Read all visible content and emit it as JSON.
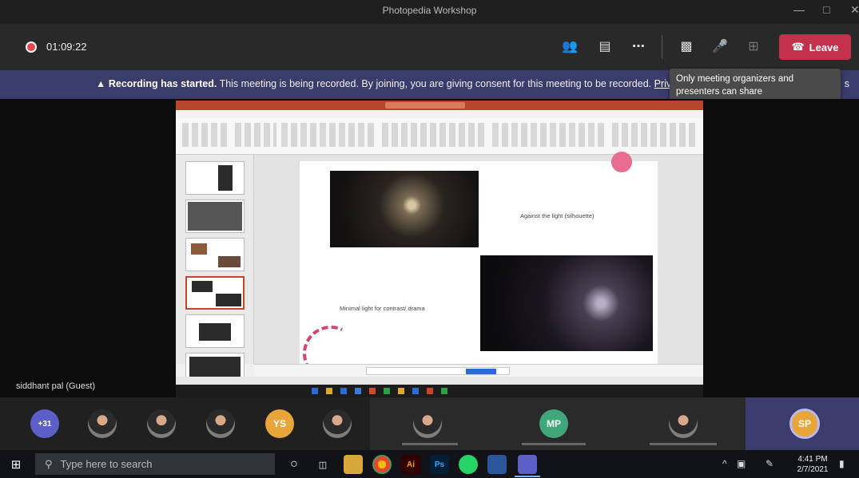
{
  "window": {
    "title": "Photopedia Workshop"
  },
  "toolbar": {
    "timer": "01:09:22",
    "leave_label": "Leave"
  },
  "banner": {
    "bold": "Recording has started.",
    "text": "This meeting is being recorded. By joining, you are giving consent for this meeting to be recorded.",
    "privacy": "Privac",
    "tail": "s"
  },
  "tooltip": {
    "text": "Only meeting organizers and presenters can share"
  },
  "stage": {
    "guest_label": "siddhant pal (Guest)"
  },
  "slide": {
    "caption1": "Against the light (silhouette)",
    "caption2": "Minimal light for contrast/ drama"
  },
  "participants": {
    "overflow_count": "+31",
    "initials": [
      "YS",
      "MP",
      "SP"
    ]
  },
  "taskbar": {
    "search_placeholder": "Type here to search",
    "time": "4:41 PM",
    "date": "2/7/2021"
  },
  "colors": {
    "leave": "#c4314b",
    "banner": "#3a3c6b",
    "recording": "#e5484d"
  }
}
